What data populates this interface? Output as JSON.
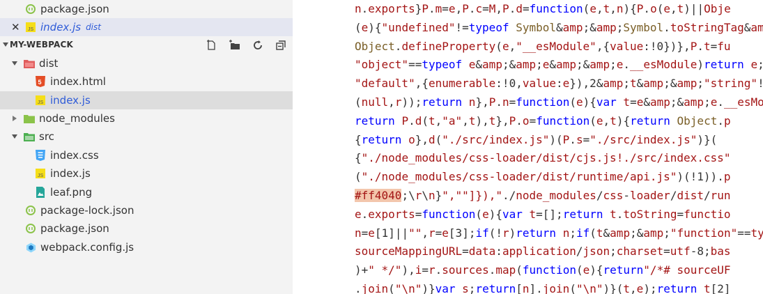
{
  "explorer": {
    "open_editors_tail": {
      "package_json": "package.json",
      "index_js": "index.js",
      "index_js_desc": "dist",
      "close_glyph": "✕"
    },
    "project_title": "MY-WEBPACK",
    "actions": [
      "new-file-icon",
      "new-folder-icon",
      "refresh-icon",
      "collapse-all-icon"
    ],
    "tree": {
      "dist": "dist",
      "dist_index_html": "index.html",
      "dist_index_js": "index.js",
      "node_modules": "node_modules",
      "src": "src",
      "src_index_css": "index.css",
      "src_index_js": "index.js",
      "src_leaf_png": "leaf.png",
      "package_lock": "package-lock.json",
      "package_json": "package.json",
      "webpack_config": "webpack.config.js"
    }
  },
  "editor": {
    "lines": [
      "n.exports}P.m=e,P.c=M,P.d=function(e,t,n){P.o(e,t)||Obje",
      "(e){\"undefined\"!=typeof Symbol&&Symbol.toStringTag&&Obje",
      "Object.defineProperty(e,\"__esModule\",{value:!0})},P.t=fu",
      "\"object\"==typeof e&&e&&e.__esModule)return e;var n=Objec",
      "\"default\",{enumerable:!0,value:e}),2&t&&\"string\"!=typeof",
      "(null,r));return n},P.n=function(e){var t=e&&e.__esModul",
      "return P.d(t,\"a\",t),t},P.o=function(e,t){return Object.p",
      "{return o},d(\"./src/index.js\")(P.s=\"./src/index.js\")}(",
      "{\"./node_modules/css-loader/dist/cjs.js!./src/index.css\"",
      "(\"./node_modules/css-loader/dist/runtime/api.js\")(!1)).p",
      "#ff4040;\\r\\n}\",\"\"]}),\"./node_modules/css-loader/dist/run",
      "e.exports=function(e){var t=[];return t.toString=functio",
      "n=e[1]||\"\",r=e[3];if(!r)return n;if(t&&\"function\"==typeo",
      "sourceMappingURL=data:application/json;charset=utf-8;bas",
      ")+\" */\"),i=r.sources.map(function(e){return\"/*# sourceUF",
      ".join(\"\\n\")}var s;return[n].join(\"\\n\")}(t,e);return t[2]"
    ],
    "highlight_token": "#ff4040",
    "colors": {
      "keyword_red": "#a31515",
      "keyword_blue": "#0000ff",
      "highlight_bg": "#f3c6ac"
    }
  }
}
